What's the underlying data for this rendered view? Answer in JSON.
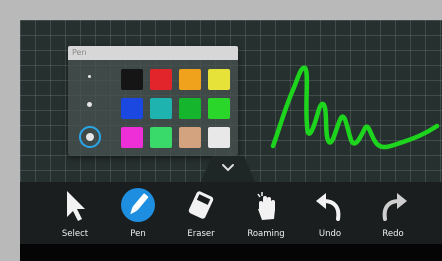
{
  "panel": {
    "title": "Pen",
    "sizes": [
      "small",
      "medium",
      "large"
    ],
    "selected_size": "large",
    "colors": [
      [
        "#151515",
        "#e2252b",
        "#f0a21c",
        "#e7e23a"
      ],
      [
        "#1a48e0",
        "#1fb3b0",
        "#15b52e",
        "#2bd62b"
      ],
      [
        "#ee2fd8",
        "#39d96a",
        "#d2a37e",
        "#e8e8e8"
      ]
    ]
  },
  "ink": {
    "color": "#1ed51e"
  },
  "toolbar": {
    "collapse_icon": "chevron-down-icon",
    "tools": [
      {
        "label": "Select",
        "icon": "cursor-arrow-icon",
        "active": false
      },
      {
        "label": "Pen",
        "icon": "pen-icon",
        "active": true
      },
      {
        "label": "Eraser",
        "icon": "eraser-icon",
        "active": false
      },
      {
        "label": "Roaming",
        "icon": "hand-icon",
        "active": false
      },
      {
        "label": "Undo",
        "icon": "undo-icon",
        "active": false
      },
      {
        "label": "Redo",
        "icon": "redo-icon",
        "active": false
      }
    ],
    "active_color": "#1e8fe0"
  }
}
